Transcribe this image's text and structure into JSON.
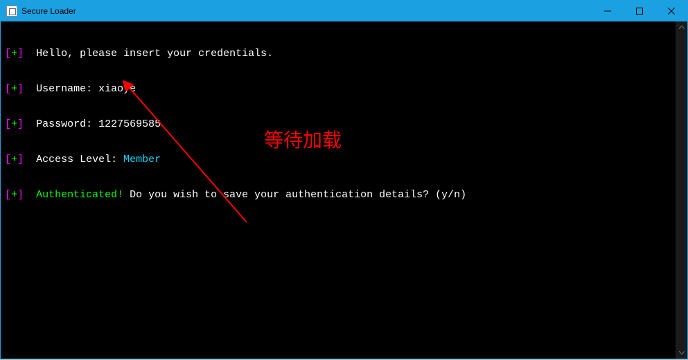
{
  "window": {
    "title": "Secure Loader"
  },
  "console": {
    "lines": [
      {
        "text": "Hello, please insert your credentials."
      },
      {
        "prefix": "Username: ",
        "value": "xiaoye"
      },
      {
        "prefix": "Password: ",
        "value": "1227569585"
      },
      {
        "prefix": "Access Level: ",
        "value": "Member",
        "value_color": "cyan"
      },
      {
        "status": "Authenticated!",
        "status_color": "green",
        "rest": " Do you wish to save your authentication details? (y/n)"
      }
    ],
    "bullet_open": "[",
    "bullet_sym": "+",
    "bullet_close": "]"
  },
  "annotation": {
    "text": "等待加载"
  }
}
